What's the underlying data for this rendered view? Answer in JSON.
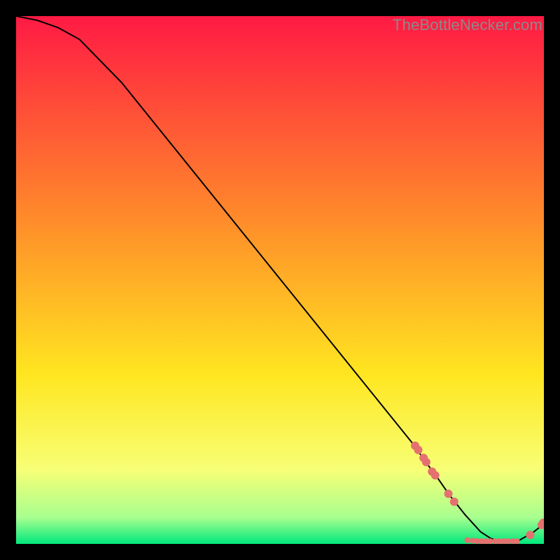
{
  "watermark": "TheBottleNecker.com",
  "colors": {
    "grad_top": "#ff1a44",
    "grad_mid1": "#ff8a2a",
    "grad_mid2": "#ffe620",
    "grad_low1": "#f7ff76",
    "grad_low2": "#a8ff8f",
    "grad_bottom": "#00e87c",
    "curve": "#000000",
    "marker": "#e4716f"
  },
  "chart_data": {
    "type": "line",
    "title": "",
    "xlabel": "",
    "ylabel": "",
    "xlim": [
      0,
      100
    ],
    "ylim": [
      0,
      100
    ],
    "series": [
      {
        "name": "curve",
        "x": [
          0,
          4,
          8,
          12,
          20,
          30,
          40,
          50,
          60,
          70,
          75,
          78,
          80,
          82,
          85,
          88,
          90,
          92,
          95,
          98,
          100
        ],
        "y": [
          100,
          99.2,
          97.8,
          95.6,
          87.4,
          75.0,
          62.6,
          50.2,
          37.8,
          25.4,
          19.2,
          15.0,
          12.3,
          9.4,
          5.6,
          2.3,
          1.0,
          0.5,
          0.5,
          2.2,
          3.8
        ]
      }
    ],
    "markers": [
      {
        "x": 75.6,
        "y": 18.6,
        "r": 1.0
      },
      {
        "x": 76.2,
        "y": 17.8,
        "r": 1.0
      },
      {
        "x": 77.2,
        "y": 16.3,
        "r": 1.0
      },
      {
        "x": 77.7,
        "y": 15.5,
        "r": 1.0
      },
      {
        "x": 78.8,
        "y": 13.7,
        "r": 1.0
      },
      {
        "x": 79.4,
        "y": 13.0,
        "r": 1.0
      },
      {
        "x": 81.9,
        "y": 9.5,
        "r": 1.0
      },
      {
        "x": 83.0,
        "y": 8.0,
        "r": 1.0
      },
      {
        "x": 85.5,
        "y": 0.7,
        "r": 0.7
      },
      {
        "x": 86.5,
        "y": 0.6,
        "r": 0.7
      },
      {
        "x": 87.3,
        "y": 0.55,
        "r": 0.7
      },
      {
        "x": 88.2,
        "y": 0.5,
        "r": 0.7
      },
      {
        "x": 89.0,
        "y": 0.5,
        "r": 0.7
      },
      {
        "x": 89.8,
        "y": 0.5,
        "r": 0.7
      },
      {
        "x": 90.7,
        "y": 0.5,
        "r": 0.7
      },
      {
        "x": 91.5,
        "y": 0.5,
        "r": 0.7
      },
      {
        "x": 92.4,
        "y": 0.5,
        "r": 0.7
      },
      {
        "x": 93.2,
        "y": 0.5,
        "r": 0.7
      },
      {
        "x": 94.1,
        "y": 0.5,
        "r": 0.7
      },
      {
        "x": 94.9,
        "y": 0.5,
        "r": 0.7
      },
      {
        "x": 97.4,
        "y": 1.7,
        "r": 1.0
      },
      {
        "x": 99.6,
        "y": 3.6,
        "r": 1.0
      },
      {
        "x": 99.9,
        "y": 4.0,
        "r": 1.0
      }
    ],
    "bottom_text": {
      "x": 90,
      "y": 1.5,
      "text": ""
    }
  }
}
